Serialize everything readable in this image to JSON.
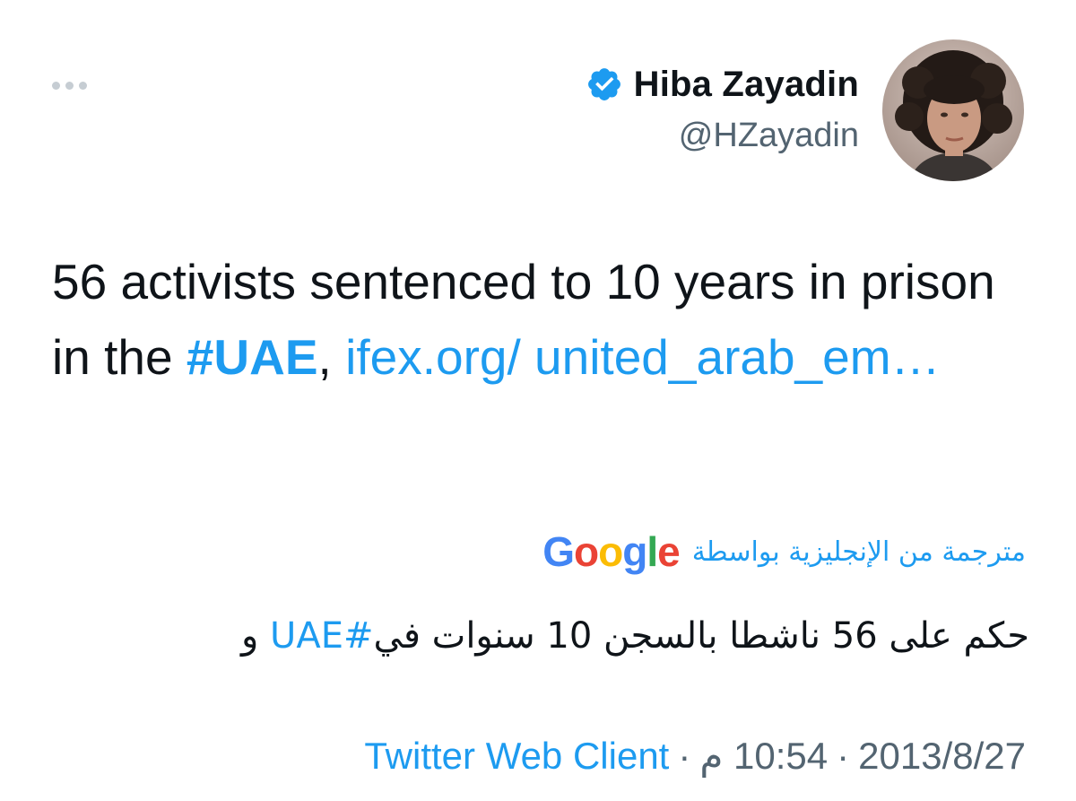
{
  "author": {
    "display_name": "Hiba Zayadin",
    "handle": "@HZayadin",
    "verified": true
  },
  "icons": {
    "more": "more-options-icon",
    "verified": "verified-badge-icon",
    "avatar": "user-avatar"
  },
  "tweet": {
    "text_part1": "56 activists sentenced to 10 years in prison in the ",
    "hashtag": "#UAE",
    "comma": ", ",
    "link": "ifex.org/ united_arab_em…"
  },
  "translation": {
    "label": "مترجمة من الإنجليزية بواسطة",
    "provider_parts": [
      "G",
      "o",
      "o",
      "g",
      "l",
      "e"
    ],
    "text_before": "حكم على 56 ناشطا بالسجن 10 سنوات في",
    "hashtag": "#UAE",
    "text_after": " و"
  },
  "meta": {
    "client": "Twitter Web Client",
    "time": "10:54 م",
    "date": "2013/8/27",
    "separator": "·"
  },
  "colors": {
    "accent": "#1d9bf0",
    "text": "#0f1419",
    "secondary": "#536471"
  }
}
